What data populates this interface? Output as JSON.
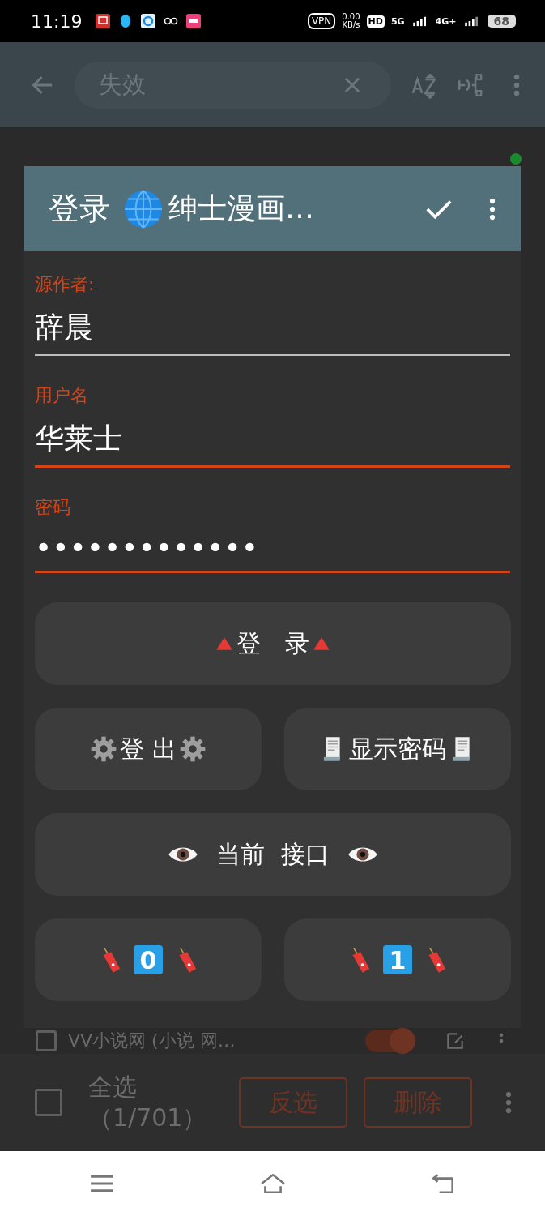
{
  "status_bar": {
    "time": "11:19",
    "vpn": "VPN",
    "speed": "0.00",
    "speed_unit": "KB/s",
    "hd": "HD",
    "network_1": "5G",
    "network_2": "4G+",
    "battery": "68"
  },
  "app_bar": {
    "search_value": "失效"
  },
  "source_row": {
    "name": "VV小说网 (小说 网…",
    "checked": false,
    "enabled": true
  },
  "dialog": {
    "title": "登录",
    "title_source": "绅士漫画…",
    "fields": [
      {
        "label": "源作者:",
        "value": "辞晨",
        "highlighted": false
      },
      {
        "label": "用户名",
        "value": "华莱士",
        "highlighted": true
      },
      {
        "label": "密码",
        "value": "•••••••••••••",
        "highlighted": true
      }
    ],
    "button_rows": [
      [
        {
          "kind": "triangle",
          "label": "登　录"
        }
      ],
      [
        {
          "kind": "gear",
          "label": "登 出"
        },
        {
          "kind": "receipt",
          "label": "显示密码"
        }
      ],
      [
        {
          "kind": "eye",
          "label": "当前  接口"
        }
      ],
      [
        {
          "kind": "tag",
          "label": "0"
        },
        {
          "kind": "tag",
          "label": "1"
        }
      ]
    ]
  },
  "bottom_bar": {
    "select_all": "全选",
    "count": "（1/701）",
    "select_all_checked": false,
    "invert": "反选",
    "delete": "删除"
  }
}
